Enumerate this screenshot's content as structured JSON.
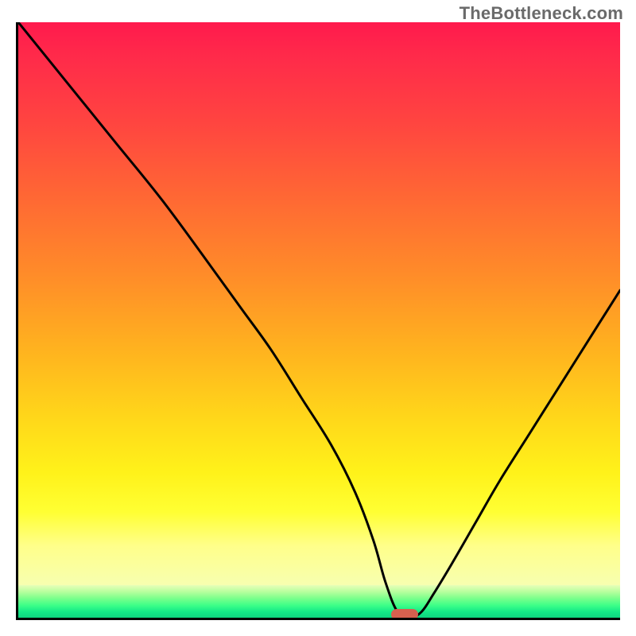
{
  "attribution": "TheBottleneck.com",
  "chart_data": {
    "type": "line",
    "title": "",
    "xlabel": "",
    "ylabel": "",
    "x_range": [
      0,
      100
    ],
    "y_range": [
      0,
      100
    ],
    "grid": false,
    "legend": false,
    "background": "vertical red-to-green gradient (red high, green low)",
    "marker": {
      "x": 64,
      "y": 0,
      "color": "#d6604f",
      "shape": "rounded-rect"
    },
    "series": [
      {
        "name": "bottleneck-curve",
        "color": "#000000",
        "x": [
          0,
          8,
          16,
          24,
          32,
          37,
          42,
          47,
          52,
          56,
          59,
          61,
          63,
          65,
          67,
          69,
          72,
          76,
          80,
          85,
          90,
          95,
          100
        ],
        "y": [
          100,
          90,
          80,
          70,
          59,
          52,
          45,
          37,
          29,
          21,
          13,
          6,
          1,
          0,
          1,
          4,
          9,
          16,
          23,
          31,
          39,
          47,
          55
        ]
      }
    ]
  }
}
